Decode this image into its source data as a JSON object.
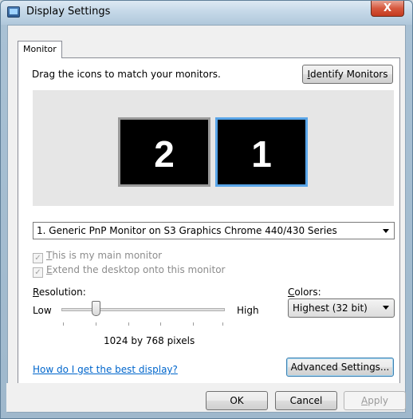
{
  "window": {
    "title": "Display Settings",
    "close_label": "X"
  },
  "tab": {
    "label": "Monitor"
  },
  "instructions": "Drag the icons to match your monitors.",
  "identify_button": {
    "mnemonic": "I",
    "rest": "dentify Monitors"
  },
  "monitors": [
    {
      "number": "2"
    },
    {
      "number": "1"
    }
  ],
  "monitor_select": {
    "value": "1. Generic PnP Monitor on S3 Graphics Chrome 440/430 Series"
  },
  "checkboxes": {
    "main_monitor": {
      "mnemonic": "T",
      "rest": "his is my main monitor",
      "checked": true
    },
    "extend_desktop": {
      "mnemonic": "E",
      "rest": "xtend the desktop onto this monitor",
      "checked": true
    }
  },
  "resolution": {
    "label_mnemonic": "R",
    "label_rest": "esolution:",
    "low": "Low",
    "high": "High",
    "value_text": "1024 by 768 pixels",
    "slider_position": 0.2
  },
  "colors": {
    "label_mnemonic": "C",
    "label_rest": "olors:",
    "value": "Highest (32 bit)"
  },
  "help_link": "How do I get the best display?",
  "advanced_button": "Advanced Settings...",
  "buttons": {
    "ok": "OK",
    "cancel": "Cancel",
    "apply_mnemonic": "A",
    "apply_rest": "pply"
  },
  "colors_palette": {
    "selected_border": "#59a5e8",
    "link": "#0066cc"
  }
}
